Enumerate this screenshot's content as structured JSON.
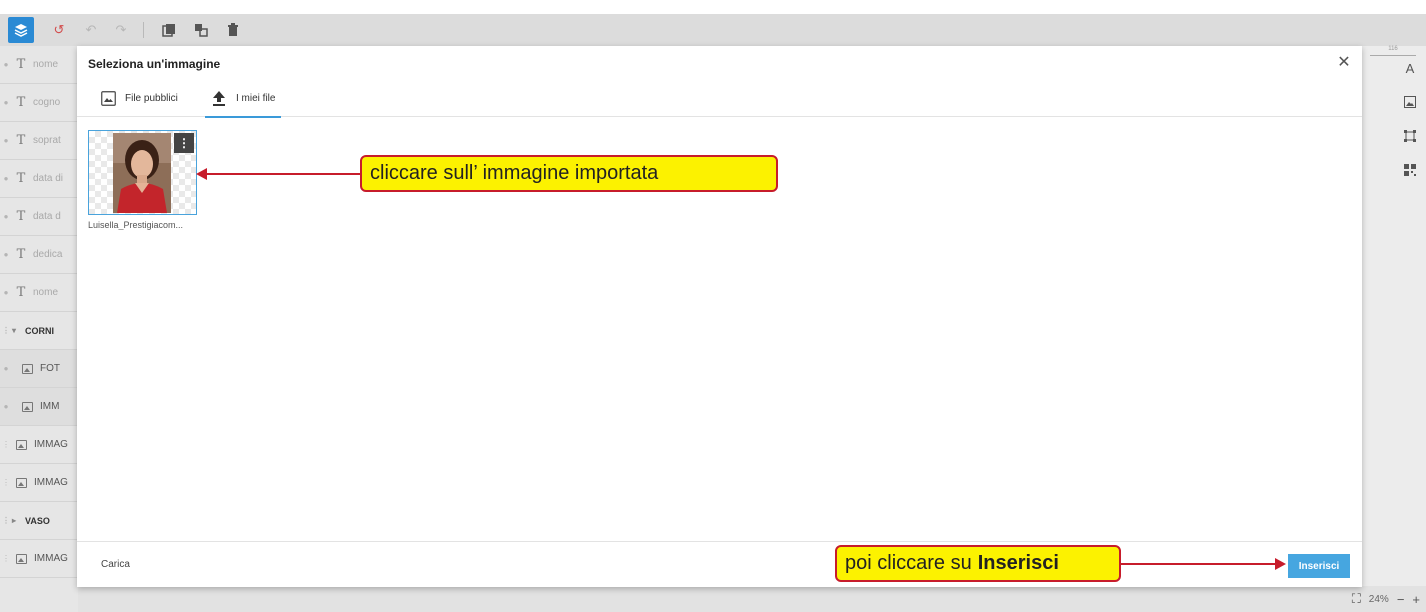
{
  "toolbar": {
    "icons": [
      "layers-icon",
      "history-icon",
      "undo-icon",
      "redo-icon",
      "duplicate-icon",
      "group-icon",
      "trash-icon"
    ]
  },
  "sidebar": {
    "layers": [
      {
        "kind": "text",
        "label": "nome"
      },
      {
        "kind": "text",
        "label": "cogno"
      },
      {
        "kind": "text",
        "label": "soprat"
      },
      {
        "kind": "text",
        "label": "data di"
      },
      {
        "kind": "text",
        "label": "data d"
      },
      {
        "kind": "text",
        "label": "dedica"
      },
      {
        "kind": "text",
        "label": "nome"
      },
      {
        "kind": "group",
        "label": "CORNI"
      },
      {
        "kind": "image",
        "label": "FOT"
      },
      {
        "kind": "image",
        "label": "IMM"
      },
      {
        "kind": "image",
        "label": "IMMAG"
      },
      {
        "kind": "image",
        "label": "IMMAG"
      },
      {
        "kind": "group",
        "label": "VASO"
      },
      {
        "kind": "image",
        "label": "IMMAG"
      }
    ]
  },
  "rightbar": {
    "ruler_label": "116",
    "tools": [
      "text-icon",
      "image-icon",
      "shape-icon",
      "qr-code-icon"
    ]
  },
  "bottombar": {
    "zoom_level": "24%"
  },
  "modal": {
    "title": "Seleziona un'immagine",
    "tabs": [
      {
        "label": "File pubblici",
        "active": false
      },
      {
        "label": "I miei file",
        "active": true
      }
    ],
    "files": [
      {
        "name": "Luisella_Prestigiacom..."
      }
    ],
    "footer": {
      "upload_label": "Carica",
      "insert_label": "Inserisci"
    }
  },
  "annotations": {
    "callout_select": "cliccare sull’ immagine importata",
    "callout_insert_prefix": "poi cliccare su",
    "callout_insert_bold": "Inserisci"
  },
  "colors": {
    "accent": "#46a6e0",
    "callout_fill": "#fcf200",
    "callout_border": "#c71c2b"
  }
}
